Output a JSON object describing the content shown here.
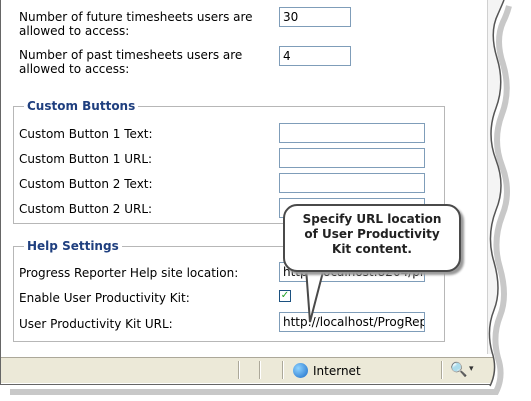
{
  "limits": {
    "future_label": "Number of future timesheets users are allowed to access:",
    "future_value": "30",
    "past_label": "Number of past timesheets users are allowed to access:",
    "past_value": "4"
  },
  "custom_buttons": {
    "legend": "Custom Buttons",
    "items": [
      {
        "label": "Custom Button 1 Text:",
        "value": ""
      },
      {
        "label": "Custom Button 1 URL:",
        "value": ""
      },
      {
        "label": "Custom Button 2 Text:",
        "value": ""
      },
      {
        "label": "Custom Button 2 URL:",
        "value": ""
      }
    ]
  },
  "help_settings": {
    "legend": "Help Settings",
    "help_site_label": "Progress Reporter Help site location:",
    "help_site_value": "http://localhost:8204/pr/",
    "upk_enable_label": "Enable User Productivity Kit:",
    "upk_enabled": true,
    "upk_url_label": "User Productivity Kit URL:",
    "upk_url_value": "http://localhost/ProgRep"
  },
  "callout": {
    "line1": "Specify URL location",
    "line2": "of User Productivity",
    "line3": "Kit content."
  },
  "statusbar": {
    "zone_label": "Internet"
  },
  "icons": {
    "checkmark": "✓",
    "zoom": "🔍",
    "caret": "▾",
    "scroll_down": "▼"
  }
}
